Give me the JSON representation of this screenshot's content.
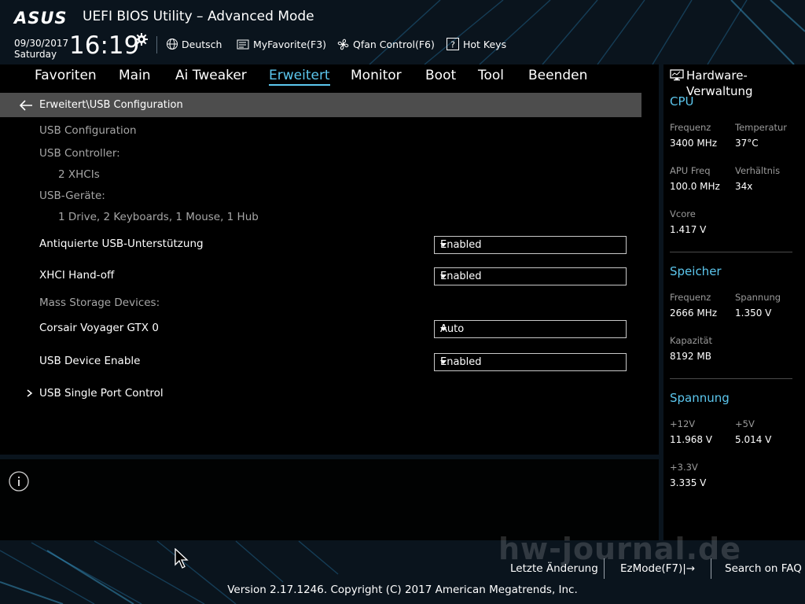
{
  "header": {
    "logo": "ASUS",
    "title": "UEFI BIOS Utility – Advanced Mode",
    "date": "09/30/2017",
    "day": "Saturday",
    "time": "16:19",
    "items": [
      {
        "label": "Deutsch",
        "icon": "globe-icon"
      },
      {
        "label": "MyFavorite(F3)",
        "icon": "favorites-icon"
      },
      {
        "label": "Qfan Control(F6)",
        "icon": "fan-icon"
      },
      {
        "label": "Hot Keys",
        "icon": "help-icon"
      }
    ]
  },
  "nav": {
    "tabs": [
      {
        "label": "Favoriten"
      },
      {
        "label": "Main"
      },
      {
        "label": "Ai Tweaker"
      },
      {
        "label": "Erweitert"
      },
      {
        "label": "Monitor"
      },
      {
        "label": "Boot"
      },
      {
        "label": "Tool"
      },
      {
        "label": "Beenden"
      }
    ],
    "active": "Erweitert"
  },
  "main": {
    "breadcrumb": "Erweitert\\USB Configuration",
    "section_title": "USB Configuration",
    "usb_controller_label": "USB Controller:",
    "usb_controller_value": "2 XHCIs",
    "usb_devices_label": "USB-Geräte:",
    "usb_devices_value": "1 Drive, 2 Keyboards, 1 Mouse, 1 Hub",
    "settings": [
      {
        "label": "Antiquierte USB-Unterstützung",
        "value": "Enabled"
      },
      {
        "label": "XHCI Hand-off",
        "value": "Enabled"
      }
    ],
    "mass_storage_label": "Mass Storage Devices:",
    "storage_settings": [
      {
        "label": "Corsair Voyager GTX 0",
        "value": "Auto"
      },
      {
        "label": "USB Device Enable",
        "value": "Enabled"
      }
    ],
    "submenu": "USB Single Port Control"
  },
  "hardware": {
    "title": "Hardware-Verwaltung",
    "cpu": {
      "heading": "CPU",
      "freq_label": "Frequenz",
      "freq_value": "3400 MHz",
      "temp_label": "Temperatur",
      "temp_value": "37°C",
      "apu_label": "APU Freq",
      "apu_value": "100.0 MHz",
      "ratio_label": "Verhältnis",
      "ratio_value": "34x",
      "vcore_label": "Vcore",
      "vcore_value": "1.417 V"
    },
    "memory": {
      "heading": "Speicher",
      "freq_label": "Frequenz",
      "freq_value": "2666 MHz",
      "volt_label": "Spannung",
      "volt_value": "1.350 V",
      "cap_label": "Kapazität",
      "cap_value": "8192 MB"
    },
    "voltage": {
      "heading": "Spannung",
      "v12_label": "+12V",
      "v12_value": "11.968 V",
      "v5_label": "+5V",
      "v5_value": "5.014 V",
      "v33_label": "+3.3V",
      "v33_value": "3.335 V"
    }
  },
  "footer": {
    "last_change": "Letzte Änderung",
    "ezmode": "EzMode(F7)|→",
    "faq": "Search on FAQ",
    "watermark": "hw-journal.de",
    "version": "Version 2.17.1246. Copyright (C) 2017 American Megatrends, Inc."
  },
  "colors": {
    "accent": "#5cc7ee",
    "breadcrumb_bg": "#4d4d4d",
    "panel_bg": "#000000"
  }
}
